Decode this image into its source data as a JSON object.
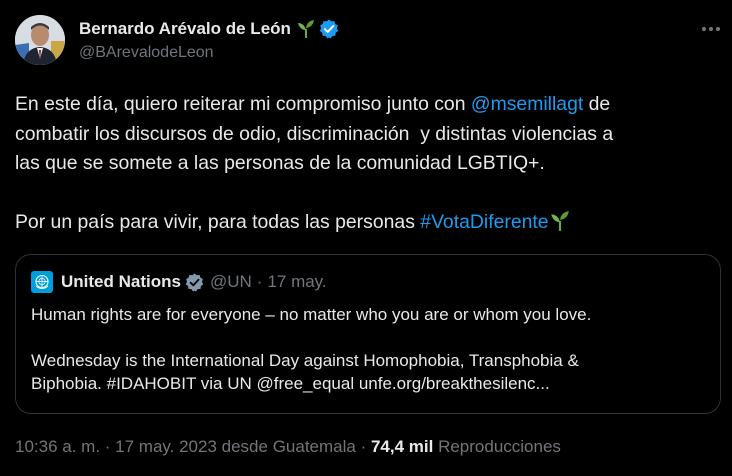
{
  "author": {
    "name": "Bernardo Arévalo de León",
    "handle": "@BArevalodeLeon"
  },
  "icons": {
    "verified": "verified-badge-icon",
    "seedling": "seedling-emoji-icon",
    "more": "more-options-icon",
    "un_logo": "un-logo-icon"
  },
  "colors": {
    "background": "#000000",
    "text": "#e7e9ea",
    "muted": "#71767b",
    "link": "#1d9bf0",
    "border": "#2f3336",
    "verified": "#1d9bf0",
    "un_blue": "#009edb"
  },
  "tweet": {
    "line1_pre": "En este día, quiero reiterar mi compromiso junto con ",
    "mention": "@msemillagt",
    "line1_post": " de",
    "line2": "combatir los discursos de odio, discriminación  y distintas violencias a",
    "line3": "las que se somete a las personas de la comunidad LGBTIQ+.",
    "line4_pre": "Por un país para vivir, para todas las personas ",
    "hashtag": "#VotaDiferente"
  },
  "quote": {
    "name": "United Nations",
    "handle": "@UN",
    "separator": "·",
    "date": "17 may.",
    "line1": "Human rights are for everyone – no matter who you are or whom you love.",
    "line2": "Wednesday is the International Day against Homophobia, Transphobia &",
    "line3": "Biphobia. #IDAHOBIT via UN @free_equal unfe.org/breakthesilenc..."
  },
  "meta": {
    "time": "10:36 a. m.",
    "sep1": " · ",
    "date_location": "17 may. 2023 desde Guatemala",
    "sep2": " · ",
    "views": "74,4 mil",
    "views_label": " Reproducciones"
  }
}
